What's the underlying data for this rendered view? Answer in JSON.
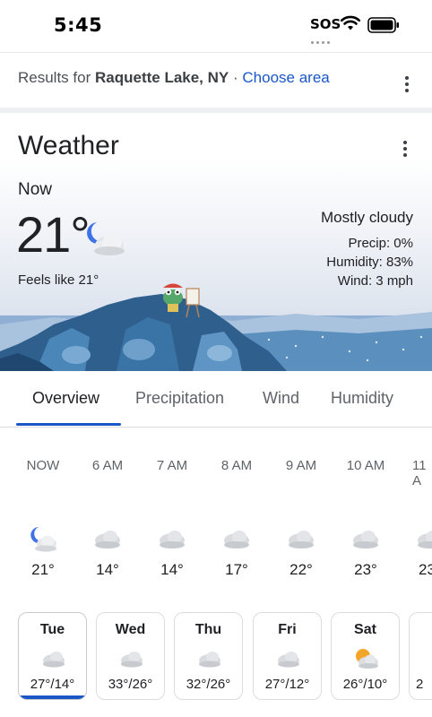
{
  "status_bar": {
    "time": "5:45",
    "sos": "SOS"
  },
  "results": {
    "prefix": "Results for",
    "location": "Raquette Lake, NY",
    "separator": "·",
    "choose_area": "Choose area"
  },
  "weather": {
    "title": "Weather",
    "now_label": "Now",
    "temperature": "21°",
    "feels_like": "Feels like 21°",
    "condition": "Mostly cloudy",
    "precip": "Precip: 0%",
    "humidity": "Humidity: 83%",
    "wind": "Wind: 3 mph",
    "icon": "partly-cloudy-night-icon"
  },
  "tabs": [
    {
      "label": "Overview",
      "active": true
    },
    {
      "label": "Precipitation",
      "active": false
    },
    {
      "label": "Wind",
      "active": false
    },
    {
      "label": "Humidity",
      "active": false
    }
  ],
  "hourly": [
    {
      "time": "NOW",
      "temp": "21°",
      "icon": "partly-cloudy-night-icon"
    },
    {
      "time": "6 AM",
      "temp": "14°",
      "icon": "cloud-icon"
    },
    {
      "time": "7 AM",
      "temp": "14°",
      "icon": "cloud-icon"
    },
    {
      "time": "8 AM",
      "temp": "17°",
      "icon": "cloud-icon"
    },
    {
      "time": "9 AM",
      "temp": "22°",
      "icon": "cloud-icon"
    },
    {
      "time": "10 AM",
      "temp": "23°",
      "icon": "cloud-icon"
    },
    {
      "time": "11 A",
      "temp": "23",
      "icon": "cloud-icon"
    }
  ],
  "daily": [
    {
      "day": "Tue",
      "temps": "27°/14°",
      "icon": "cloud-icon",
      "active": true
    },
    {
      "day": "Wed",
      "temps": "33°/26°",
      "icon": "cloud-icon",
      "active": false
    },
    {
      "day": "Thu",
      "temps": "32°/26°",
      "icon": "cloud-icon",
      "active": false
    },
    {
      "day": "Fri",
      "temps": "27°/12°",
      "icon": "cloud-icon",
      "active": false
    },
    {
      "day": "Sat",
      "temps": "26°/10°",
      "icon": "partly-sunny-icon",
      "active": false
    },
    {
      "day": "",
      "temps": "2",
      "icon": "",
      "active": false
    }
  ],
  "colors": {
    "accent": "#1a57c6",
    "text": "#202124",
    "muted": "#5f6368"
  }
}
